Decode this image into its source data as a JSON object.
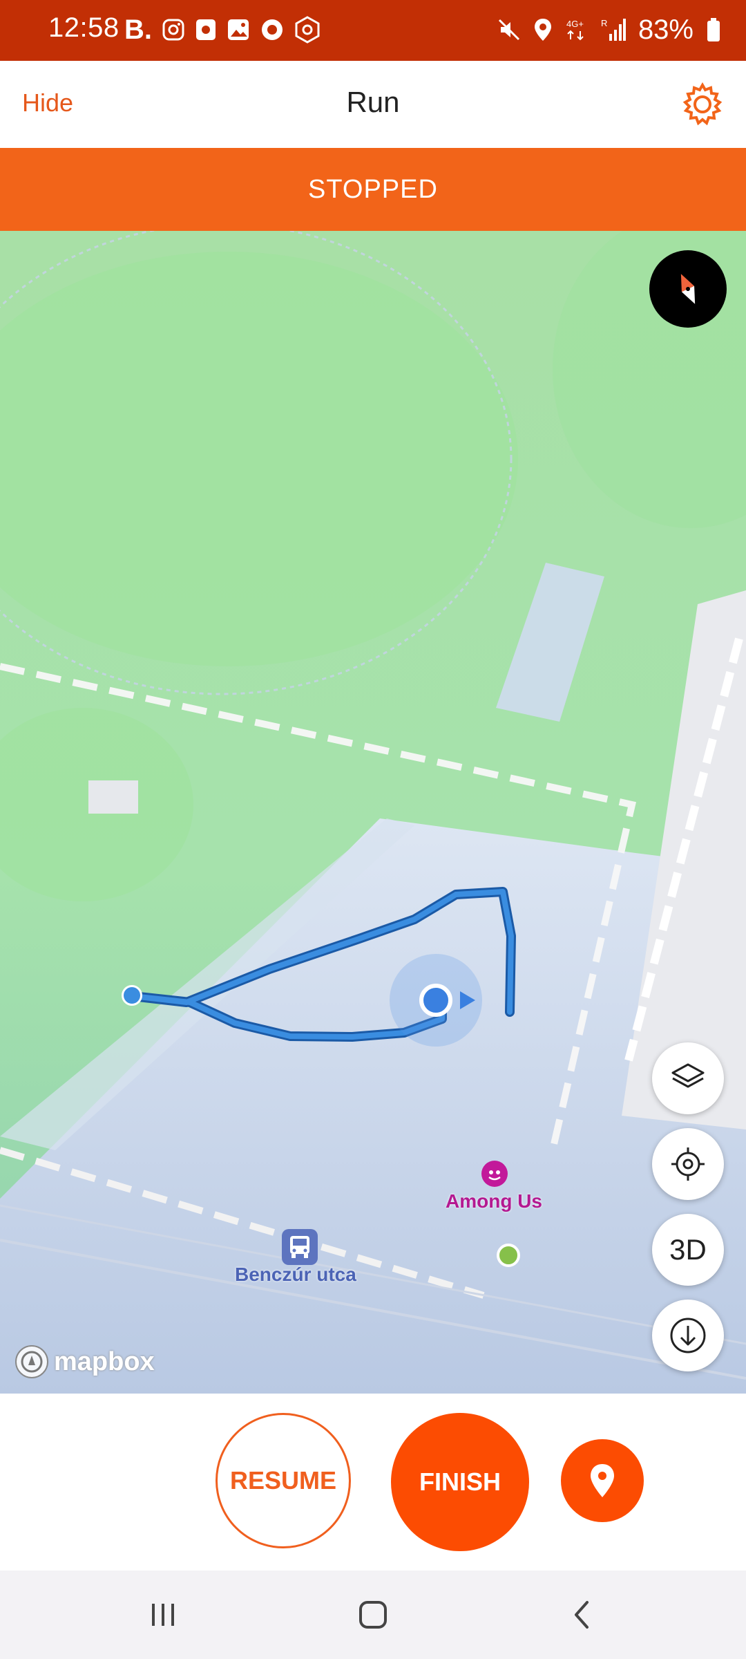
{
  "status_bar": {
    "time": "12:58",
    "battery": "83%",
    "left_icons": [
      "b-letter-icon",
      "instagram-icon",
      "clock-app-icon",
      "gallery-icon",
      "record-icon",
      "hexagon-icon"
    ],
    "right_icons": [
      "mute-icon",
      "location-icon",
      "4g-plus-icon",
      "signal-icon",
      "battery-icon"
    ]
  },
  "header": {
    "hide_label": "Hide",
    "title": "Run",
    "settings_icon": "gear-icon"
  },
  "banner": {
    "status": "STOPPED"
  },
  "map": {
    "labels": {
      "poi": "Among Us",
      "bus_stop": "Benczúr utca",
      "attribution": "mapbox"
    },
    "controls": [
      "compass-icon",
      "layers-icon",
      "locate-icon",
      "3D",
      "download-icon"
    ],
    "control_3d_label": "3D",
    "colors": {
      "route": "#3a8de0",
      "route_outline": "#1b5aa6",
      "start_marker": "#86c04a",
      "park": "#a9e3a8"
    }
  },
  "actions": {
    "resume": "RESUME",
    "finish": "FINISH",
    "pin_icon": "location-pin-icon"
  },
  "nav": [
    "recent-apps-icon",
    "home-icon",
    "back-icon"
  ],
  "colors": {
    "accent": "#fc4c02",
    "status_bar": "#c22f05"
  }
}
